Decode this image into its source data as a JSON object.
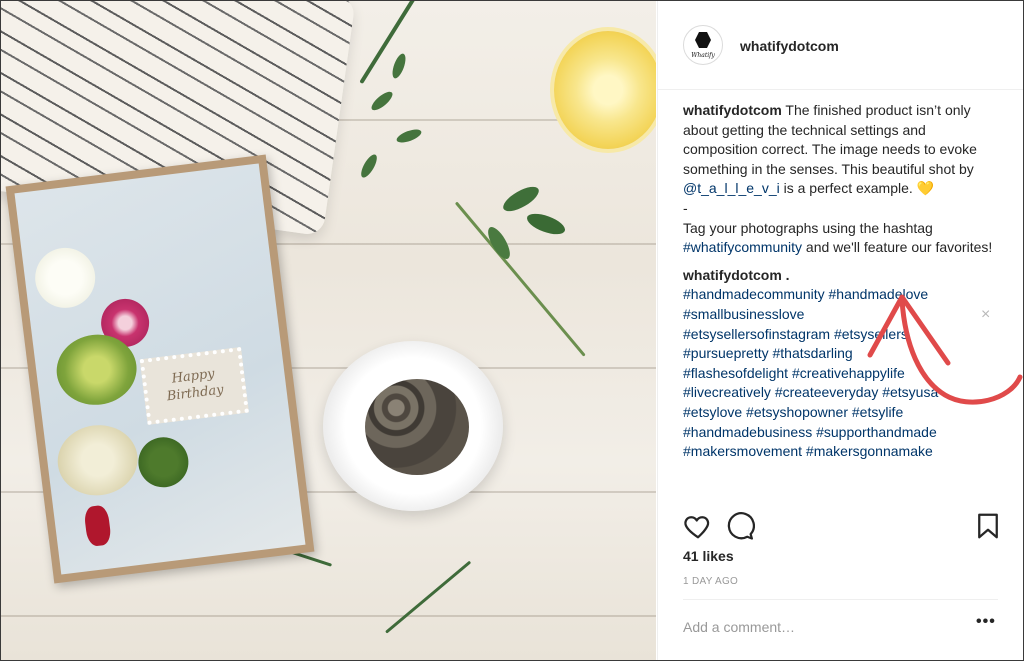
{
  "account": {
    "handle": "whatifydotcom",
    "avatar_text": "Whatify"
  },
  "caption": {
    "user": "whatifydotcom",
    "text_1": " The finished product isn’t only about getting the technical settings and composition correct. The image needs to evoke something in the senses. This beautiful shot by ",
    "mention": "@t_a_l_l_e_v_i",
    "text_2": " is a perfect example. ",
    "emoji": "💛",
    "dash": "-",
    "text_3": "Tag your photographs using the hashtag ",
    "hashtag": "#whatifycommunity",
    "text_4": " and we'll feature our favorites!"
  },
  "comment": {
    "user": "whatifydotcom .",
    "hashtags": [
      "#handmadecommunity #handmadelove",
      "#smallbusinesslove",
      "#etsysellersofinstagram #etsysellers",
      "#pursuepretty #thatsdarling",
      "#flashesofdelight #creativehappylife",
      "#livecreatively #createeveryday #etsyusa",
      "#etsylove #etsyshopowner #etsylife",
      "#handmadebusiness #supporthandmade",
      "#makersmovement #makersgonnamake"
    ],
    "close_glyph": "×"
  },
  "photo": {
    "card_text_line1": "Happy",
    "card_text_line2": "Birthday"
  },
  "engagement": {
    "likes": "41 likes",
    "time": "1 DAY AGO"
  },
  "add_comment": {
    "placeholder": "Add a comment…",
    "more_glyph": "•••"
  },
  "icons": {
    "like": "heart-outline-icon",
    "comment": "speech-bubble-icon",
    "save": "bookmark-icon",
    "avatar": "hexagon-logo-icon"
  },
  "colors": {
    "link": "#003569",
    "annotation": "#e04a4a",
    "muted": "#999999"
  }
}
